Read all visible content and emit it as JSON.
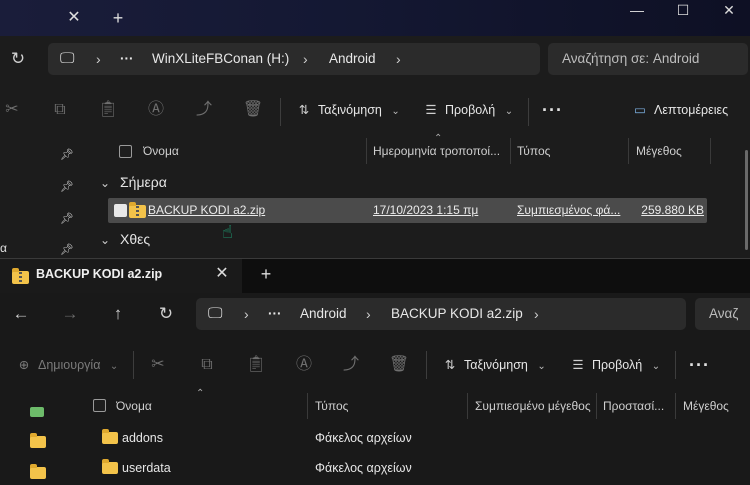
{
  "window1": {
    "path": [
      "WinXLiteFBConan (H:)",
      "Android"
    ],
    "search_placeholder": "Αναζήτηση σε: Android",
    "toolbar": {
      "sort_label": "Ταξινόμηση",
      "view_label": "Προβολή",
      "details_label": "Λεπτομέρειες"
    },
    "columns": [
      "Όνομα",
      "Ημερομηνία τροποποί...",
      "Τύπος",
      "Μέγεθος"
    ],
    "groups": [
      "Σήμερα",
      "Χθες"
    ],
    "sidebar_partial_label": "α",
    "files": [
      {
        "name": "BACKUP KODI a2.zip",
        "date": "17/10/2023 1:15 πμ",
        "type": "Συμπιεσμένος φά...",
        "size": "259.880 KB",
        "selected": true
      }
    ]
  },
  "window2": {
    "tab_title": "BACKUP KODI a2.zip",
    "path": [
      "Android",
      "BACKUP KODI a2.zip"
    ],
    "search_partial": "Αναζ",
    "toolbar": {
      "new_label": "Δημιουργία",
      "sort_label": "Ταξινόμηση",
      "view_label": "Προβολή"
    },
    "columns": [
      "Όνομα",
      "Τύπος",
      "Συμπιεσμένο μέγεθος",
      "Προστασί...",
      "Μέγεθος"
    ],
    "items": [
      {
        "name": "addons",
        "type": "Φάκελος αρχείων"
      },
      {
        "name": "userdata",
        "type": "Φάκελος αρχείων"
      }
    ]
  },
  "colors": {
    "folder": "#f3c34a",
    "selection": "#4b4b4b",
    "cursor": "#1fae7e"
  }
}
